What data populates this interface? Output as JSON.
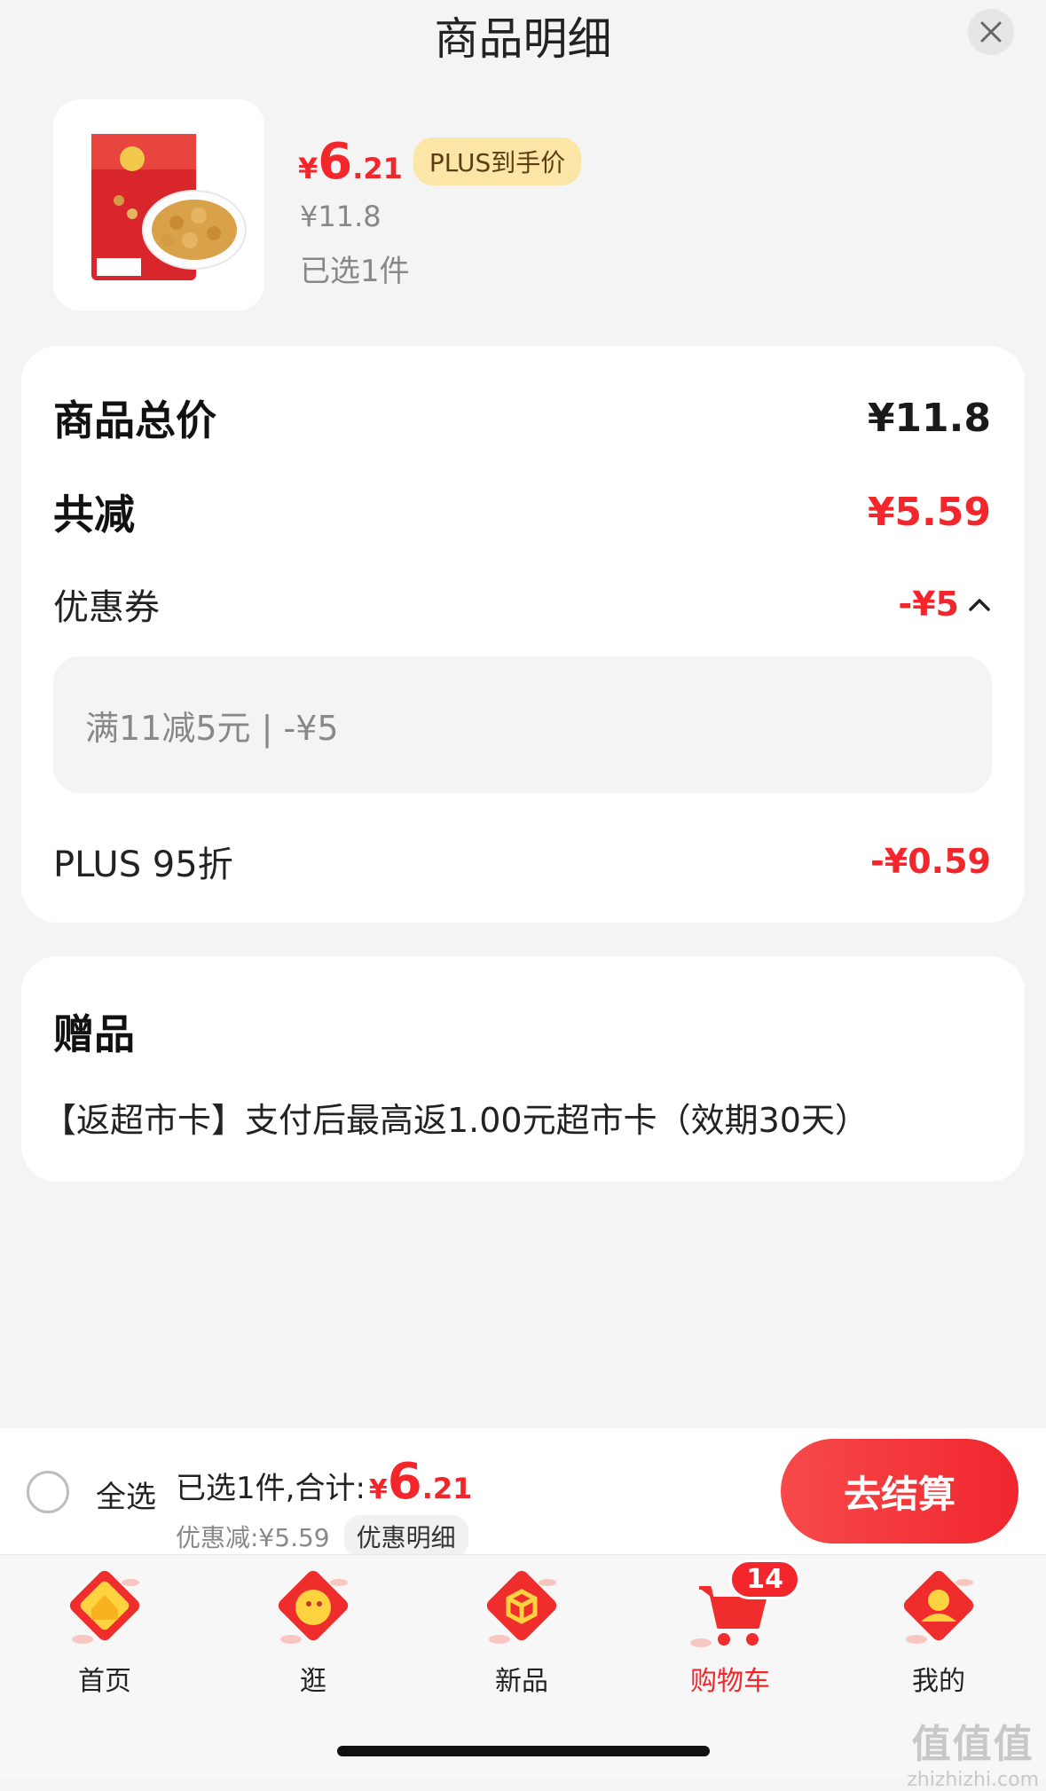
{
  "header": {
    "title": "商品明细"
  },
  "product": {
    "price_yen": "¥",
    "price_int": "6",
    "price_dec": ".21",
    "plus_badge": "PLUS到手价",
    "original_price": "¥11.8",
    "selected": "已选1件"
  },
  "breakdown": {
    "total_label": "商品总价",
    "total_value": "¥11.8",
    "reduce_label": "共减",
    "reduce_value": "¥5.59",
    "coupon_label": "优惠券",
    "coupon_value": "-¥5",
    "coupon_detail": "满11减5元 | -¥5",
    "plus_label": "PLUS 95折",
    "plus_value": "-¥0.59"
  },
  "gift": {
    "title": "赠品",
    "text": "【返超市卡】支付后最高返1.00元超市卡（效期30天）"
  },
  "checkout": {
    "select_all": "全选",
    "summary_prefix": "已选1件,合计:",
    "summary_yen": "¥",
    "summary_int": "6",
    "summary_dec": ".21",
    "discount_text": "优惠减:¥5.59",
    "detail_chip": "优惠明细",
    "button": "去结算"
  },
  "tabs": [
    {
      "label": "首页",
      "icon": "home-icon"
    },
    {
      "label": "逛",
      "icon": "browse-icon"
    },
    {
      "label": "新品",
      "icon": "new-icon"
    },
    {
      "label": "购物车",
      "icon": "cart-icon",
      "badge": "14",
      "active": true
    },
    {
      "label": "我的",
      "icon": "profile-icon"
    }
  ],
  "watermark": {
    "logo": "值值值",
    "url": "zhizhizhi.com"
  },
  "colors": {
    "accent": "#f3262c",
    "plus_badge_bg": "#fbe6a8"
  }
}
